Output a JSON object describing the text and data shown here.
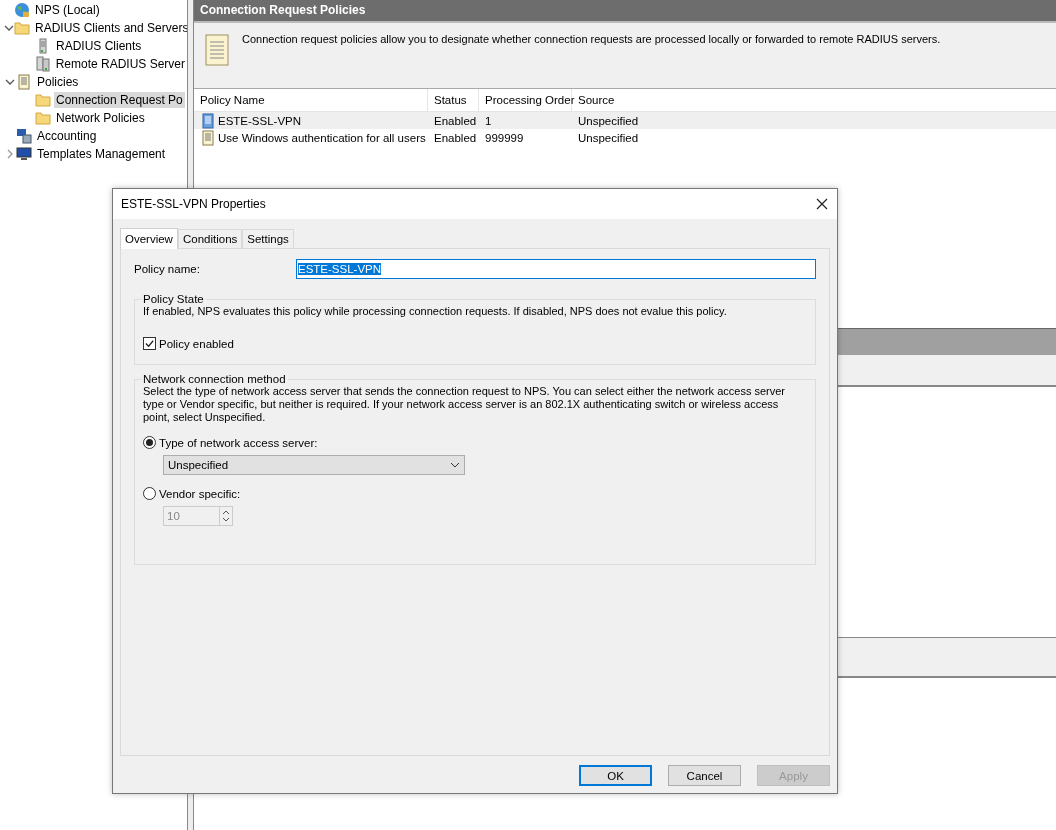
{
  "tree": [
    {
      "label": "NPS (Local)",
      "kind": "globe",
      "selected": false,
      "children": [
        {
          "label": "RADIUS Clients and Servers",
          "kind": "folder",
          "expanded": true,
          "selected": false,
          "children": [
            {
              "label": "RADIUS Clients",
              "kind": "server",
              "selected": false
            },
            {
              "label": "Remote RADIUS Server",
              "kind": "servers",
              "selected": false
            }
          ]
        },
        {
          "label": "Policies",
          "kind": "scroll",
          "expanded": true,
          "selected": false,
          "children": [
            {
              "label": "Connection Request Po",
              "kind": "folder",
              "selected": true
            },
            {
              "label": "Network Policies",
              "kind": "folder",
              "selected": false
            }
          ]
        },
        {
          "label": "Accounting",
          "kind": "accounting",
          "selected": false
        },
        {
          "label": "Templates Management",
          "kind": "monitor",
          "expanded": false,
          "selected": false
        }
      ]
    }
  ],
  "panel": {
    "title": "Connection Request Policies",
    "description": "Connection request policies allow you to designate whether connection requests are processed locally or forwarded to remote RADIUS servers.",
    "columns": [
      "Policy Name",
      "Status",
      "Processing Order",
      "Source"
    ],
    "rows": [
      {
        "kind": "vpn",
        "selected": true,
        "cells": [
          "ESTE-SSL-VPN",
          "Enabled",
          "1",
          "Unspecified"
        ]
      },
      {
        "kind": "scroll",
        "selected": false,
        "cells": [
          "Use Windows authentication for all users",
          "Enabled",
          "999999",
          "Unspecified"
        ]
      }
    ]
  },
  "dialog": {
    "title": "ESTE-SSL-VPN Properties",
    "tabs": [
      {
        "label": "Overview",
        "selected": true
      },
      {
        "label": "Conditions",
        "selected": false
      },
      {
        "label": "Settings",
        "selected": false
      }
    ],
    "policy_name": {
      "label": "Policy name:",
      "value": "ESTE-SSL-VPN",
      "highlighted": true
    },
    "policy_state": {
      "title": "Policy State",
      "description": "If enabled, NPS evaluates this policy while processing connection requests. If disabled, NPS does not evalue this policy.",
      "checkbox": {
        "label": "Policy enabled",
        "checked": true
      }
    },
    "method": {
      "title": "Network connection method",
      "description": "Select the type of network access server that sends the connection request to NPS. You can select either the network access server type or Vendor specific, but neither is required.  If your network access server is an 802.1X authenticating switch or wireless access point, select Unspecified.",
      "options": [
        {
          "label": "Type of network access server:",
          "selected": true,
          "kind": "dropdown",
          "value": "Unspecified",
          "disabled": false
        },
        {
          "label": "Vendor specific:",
          "selected": false,
          "kind": "spinner",
          "value": "10",
          "disabled": true
        }
      ]
    },
    "buttons": [
      {
        "label": "OK",
        "default": true,
        "disabled": false
      },
      {
        "label": "Cancel",
        "default": false,
        "disabled": false
      },
      {
        "label": "Apply",
        "default": false,
        "disabled": true
      }
    ]
  }
}
